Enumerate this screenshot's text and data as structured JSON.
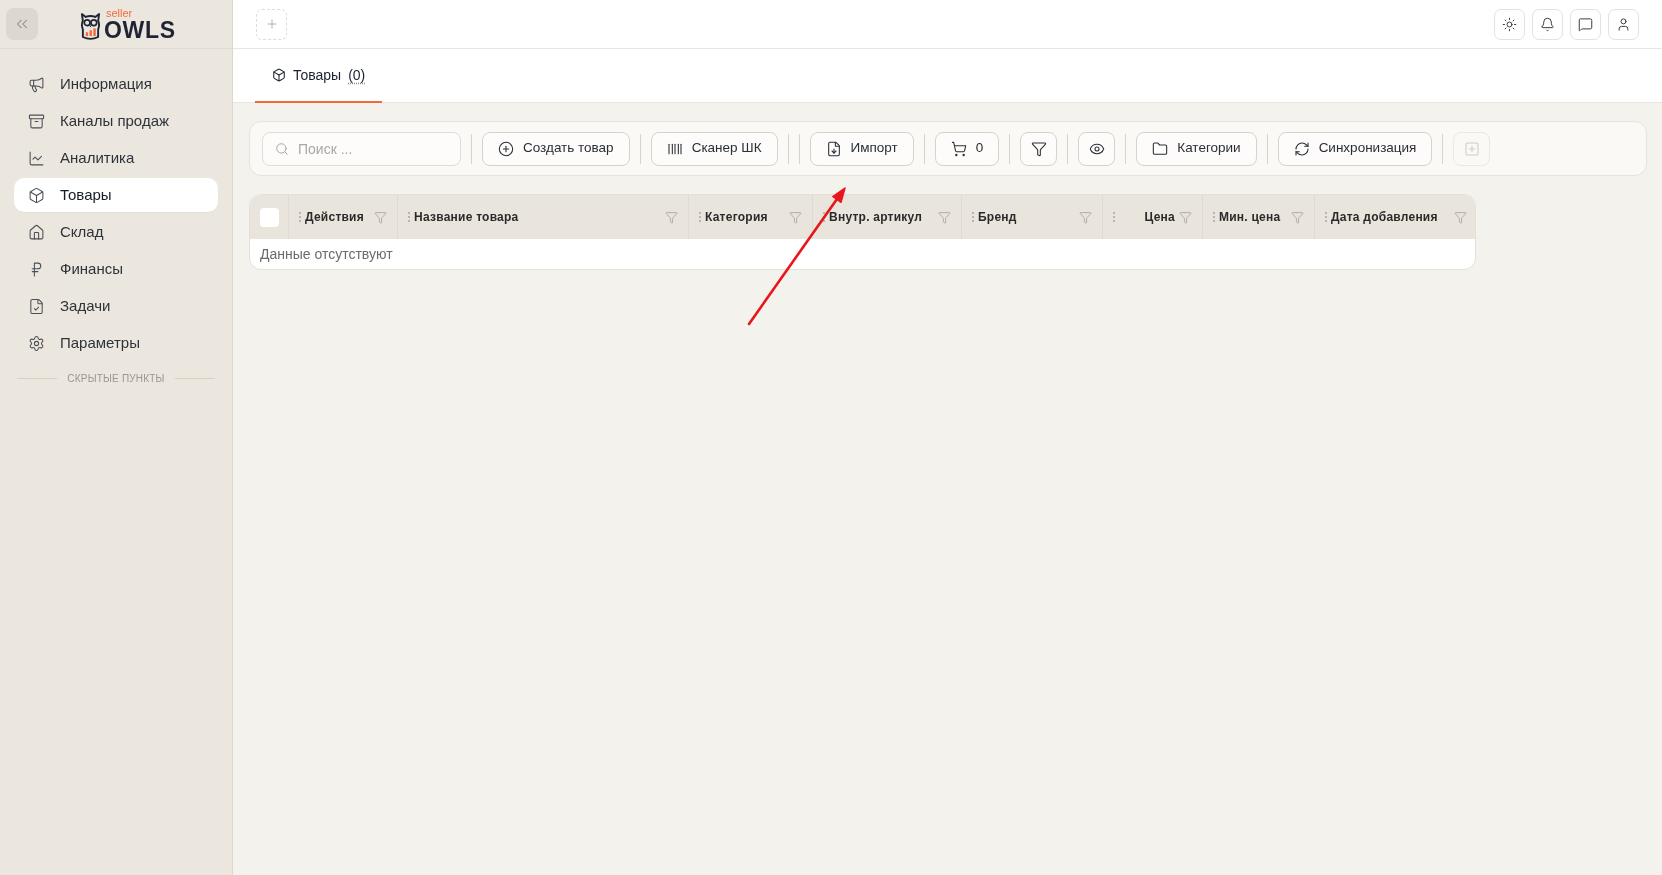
{
  "sidebar": {
    "logo": {
      "tagline": "seller",
      "name": "OWLS"
    },
    "items": [
      {
        "label": "Информация",
        "selected": false
      },
      {
        "label": "Каналы продаж",
        "selected": false
      },
      {
        "label": "Аналитика",
        "selected": false
      },
      {
        "label": "Товары",
        "selected": true
      },
      {
        "label": "Склад",
        "selected": false
      },
      {
        "label": "Финансы",
        "selected": false
      },
      {
        "label": "Задачи",
        "selected": false
      },
      {
        "label": "Параметры",
        "selected": false
      }
    ],
    "hidden_section": "СКРЫТЫЕ ПУНКТЫ"
  },
  "tabs": [
    {
      "label": "Товары",
      "count": "(0)",
      "selected": true
    }
  ],
  "toolbar": {
    "items": [
      {
        "kind": "search",
        "placeholder": "Поиск ..."
      },
      {
        "kind": "separator"
      },
      {
        "kind": "button",
        "label": "Создать товар",
        "disabled": false
      },
      {
        "kind": "separator"
      },
      {
        "kind": "button",
        "label": "Сканер ШК",
        "disabled": false
      },
      {
        "kind": "separator"
      },
      {
        "kind": "separator"
      },
      {
        "kind": "button",
        "label": "Импорт",
        "disabled": false
      },
      {
        "kind": "separator"
      },
      {
        "kind": "button",
        "label": "0",
        "disabled": false
      },
      {
        "kind": "separator"
      },
      {
        "kind": "icon-button",
        "disabled": false
      },
      {
        "kind": "separator"
      },
      {
        "kind": "icon-button",
        "disabled": false
      },
      {
        "kind": "separator"
      },
      {
        "kind": "button",
        "label": "Категории",
        "disabled": false
      },
      {
        "kind": "separator"
      },
      {
        "kind": "button",
        "label": "Синхронизация",
        "disabled": false
      },
      {
        "kind": "separator"
      },
      {
        "kind": "icon-button",
        "disabled": true
      }
    ]
  },
  "table": {
    "select_all": {
      "checked": false
    },
    "columns": [
      {
        "label": "Действия"
      },
      {
        "label": "Название товара"
      },
      {
        "label": "Категория"
      },
      {
        "label": "Внутр. артикул"
      },
      {
        "label": "Бренд"
      },
      {
        "label": "Цена"
      },
      {
        "label": "Мин. цена"
      },
      {
        "label": "Дата добавления"
      }
    ],
    "empty_message": "Данные отсутствуют"
  }
}
